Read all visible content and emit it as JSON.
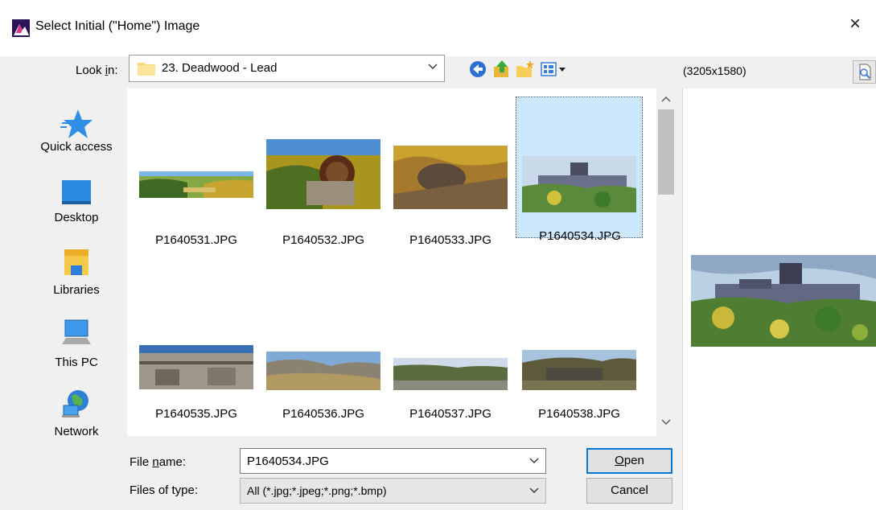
{
  "window": {
    "title": "Select Initial (\"Home\") Image",
    "close_glyph": "×"
  },
  "lookin": {
    "label_pre": "Look ",
    "label_mn": "i",
    "label_post": "n:",
    "value": "23. Deadwood - Lead"
  },
  "toolbar": {
    "icons": [
      "back-icon",
      "up-folder-icon",
      "new-folder-icon",
      "view-menu-icon"
    ]
  },
  "places": [
    {
      "label": "Quick access",
      "icon": "star-icon"
    },
    {
      "label": "Desktop",
      "icon": "desktop-icon"
    },
    {
      "label": "Libraries",
      "icon": "libraries-icon"
    },
    {
      "label": "This PC",
      "icon": "computer-icon"
    },
    {
      "label": "Network",
      "icon": "network-icon"
    }
  ],
  "files": [
    {
      "name": "P1640531.JPG",
      "selected": false
    },
    {
      "name": "P1640532.JPG",
      "selected": false
    },
    {
      "name": "P1640533.JPG",
      "selected": false
    },
    {
      "name": "P1640534.JPG",
      "selected": true
    },
    {
      "name": "P1640535.JPG",
      "selected": false
    },
    {
      "name": "P1640536.JPG",
      "selected": false
    },
    {
      "name": "P1640537.JPG",
      "selected": false
    },
    {
      "name": "P1640538.JPG",
      "selected": false
    }
  ],
  "preview": {
    "size": "(3205x1580)"
  },
  "filename": {
    "label_pre": "File ",
    "label_mn": "n",
    "label_post": "ame:",
    "value": "P1640534.JPG"
  },
  "filetype": {
    "label": "Files of type:",
    "value": "All (*.jpg;*.jpeg;*.png;*.bmp)"
  },
  "buttons": {
    "open_mn": "O",
    "open_rest": "pen",
    "cancel": "Cancel"
  },
  "colors": {
    "selection": "#cce8ff",
    "accent": "#0078d7"
  }
}
